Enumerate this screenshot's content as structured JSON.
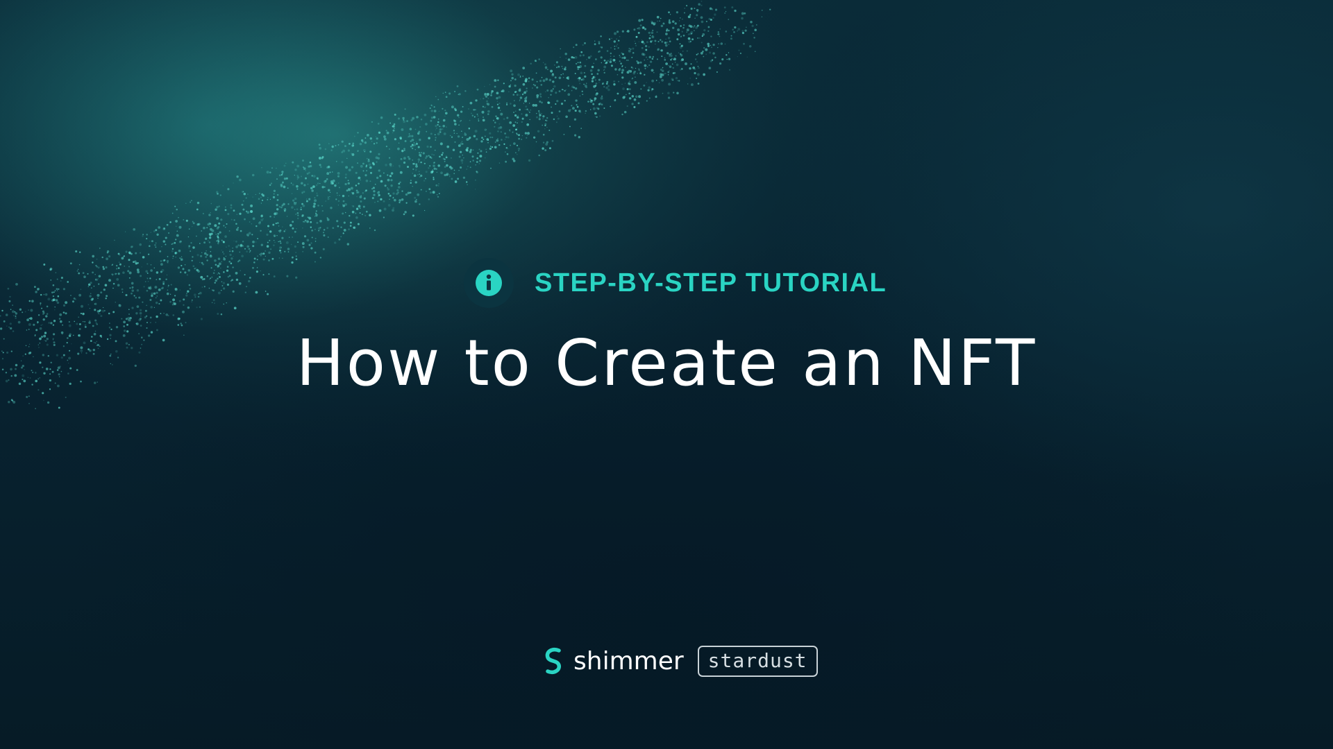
{
  "eyebrow": {
    "icon": "info-icon",
    "text": "STEP-BY-STEP TUTORIAL"
  },
  "title": "How to Create an NFT",
  "brand": {
    "logo_icon": "shimmer-logo-icon",
    "name": "shimmer",
    "tag": "stardust"
  },
  "colors": {
    "background": "#071e29",
    "accent": "#2ad4c3",
    "title": "#ffffff",
    "badge": "#0b3440"
  }
}
